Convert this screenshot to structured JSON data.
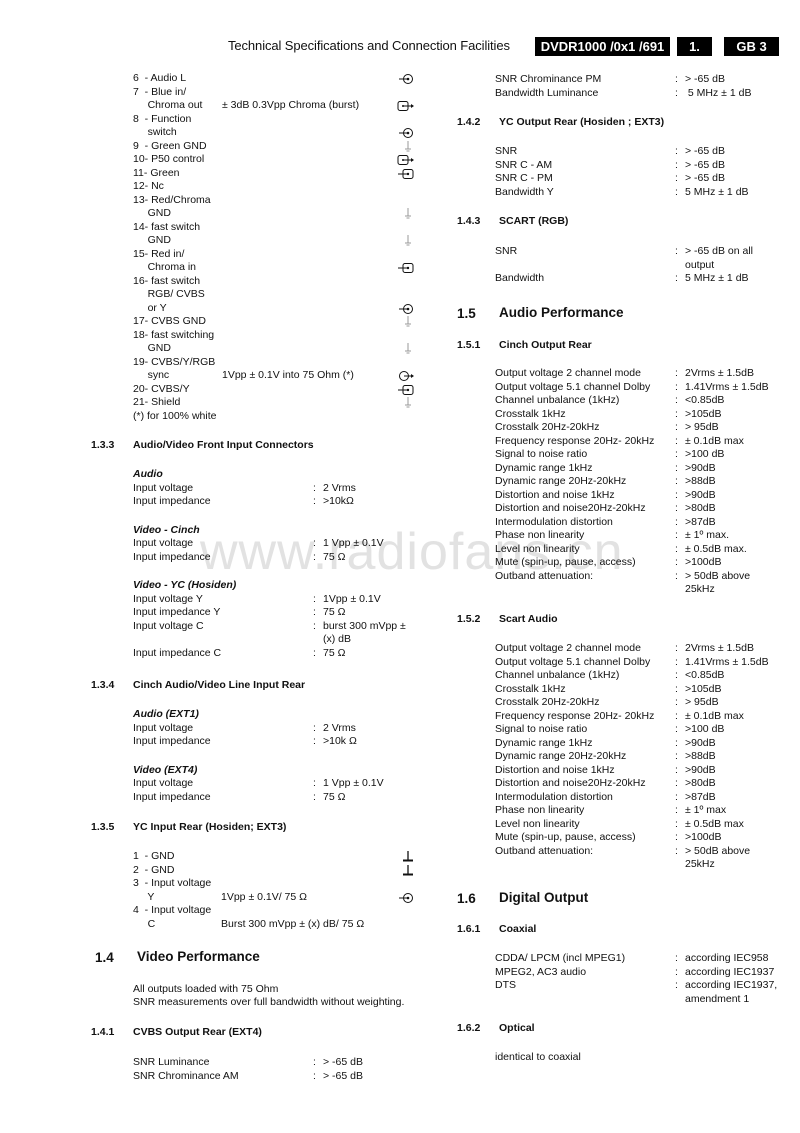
{
  "header": {
    "title": "Technical Specifications and Connection Facilities",
    "model": "DVDR1000 /0x1 /691",
    "chapter": "1.",
    "page": "GB 3"
  },
  "watermark": "www.radiofans.cn",
  "scart_pins": [
    {
      "lines": [
        "6  - Audio L"
      ],
      "spec": "",
      "icon": "input-jack-icon"
    },
    {
      "lines": [
        "7  - Blue in/",
        "     Chroma out"
      ],
      "spec": "± 3dB 0.3Vpp Chroma (burst)",
      "icon": "bidirectional-box-output-icon"
    },
    {
      "lines": [
        "8  - Function",
        "     switch"
      ],
      "spec": "",
      "icon": "input-jack-icon"
    },
    {
      "lines": [
        "9  - Green GND"
      ],
      "spec": "",
      "icon": "ground-icon"
    },
    {
      "lines": [
        "10- P50 control"
      ],
      "spec": "",
      "icon": "box-output-icon"
    },
    {
      "lines": [
        "11- Green"
      ],
      "spec": "",
      "icon": "box-input-icon"
    },
    {
      "lines": [
        "12- Nc"
      ],
      "spec": "",
      "icon": ""
    },
    {
      "lines": [
        "13- Red/Chroma",
        "     GND"
      ],
      "spec": "",
      "icon": "ground-icon"
    },
    {
      "lines": [
        "14- fast switch",
        "     GND"
      ],
      "spec": "",
      "icon": "ground-icon"
    },
    {
      "lines": [
        "15- Red in/",
        "     Chroma in"
      ],
      "spec": "",
      "icon": "box-input-icon"
    },
    {
      "lines": [
        "16- fast switch",
        "     RGB/ CVBS",
        "     or Y"
      ],
      "spec": "",
      "icon": "input-jack-icon"
    },
    {
      "lines": [
        "17- CVBS GND"
      ],
      "spec": "",
      "icon": "ground-icon"
    },
    {
      "lines": [
        "18- fast switching",
        "     GND"
      ],
      "spec": "",
      "icon": "ground-icon"
    },
    {
      "lines": [
        "19- CVBS/Y/RGB",
        "     sync"
      ],
      "spec": "1Vpp ± 0.1V into 75 Ohm (*)",
      "icon": "output-jack-icon"
    },
    {
      "lines": [
        "20- CVBS/Y"
      ],
      "spec": "",
      "icon": "box-input-icon"
    },
    {
      "lines": [
        "21- Shield"
      ],
      "spec": "",
      "icon": "ground-icon"
    },
    {
      "lines": [
        "(*) for 100% white"
      ],
      "spec": "",
      "icon": ""
    }
  ],
  "s133": {
    "num": "1.3.3",
    "title": "Audio/Video Front Input Connectors",
    "groups": [
      {
        "heading": "Audio",
        "rows": [
          {
            "label": "Input voltage",
            "value": "2 Vrms"
          },
          {
            "label": "Input impedance",
            "value": ">10kΩ"
          }
        ]
      },
      {
        "heading": "Video - Cinch",
        "rows": [
          {
            "label": "Input voltage",
            "value": "1 Vpp ± 0.1V"
          },
          {
            "label": "Input impedance",
            "value": "75 Ω"
          }
        ]
      },
      {
        "heading": "Video - YC (Hosiden)",
        "rows": [
          {
            "label": "Input voltage Y",
            "value": "1Vpp ± 0.1V"
          },
          {
            "label": "Input impedance Y",
            "value": "75 Ω"
          },
          {
            "label": "Input voltage C",
            "value": "burst 300 mVpp ±",
            "value2": "(x) dB"
          },
          {
            "label": "Input impedance C",
            "value": "75 Ω"
          }
        ]
      }
    ]
  },
  "s134": {
    "num": "1.3.4",
    "title": "Cinch Audio/Video Line Input Rear",
    "groups": [
      {
        "heading": "Audio (EXT1)",
        "rows": [
          {
            "label": "Input voltage",
            "value": "2 Vrms"
          },
          {
            "label": "Input impedance",
            "value": ">10k Ω"
          }
        ]
      },
      {
        "heading": "Video (EXT4)",
        "rows": [
          {
            "label": "Input voltage",
            "value": "1 Vpp ± 0.1V"
          },
          {
            "label": "Input impedance",
            "value": "75 Ω"
          }
        ]
      }
    ]
  },
  "s135": {
    "num": "1.3.5",
    "title": "YC  Input Rear (Hosiden; EXT3)",
    "pins": [
      {
        "lines": [
          "1  - GND"
        ],
        "spec": "",
        "icon": "ground-bar-icon"
      },
      {
        "lines": [
          "2  - GND"
        ],
        "spec": "",
        "icon": "ground-bar-icon"
      },
      {
        "lines": [
          "3  - Input voltage",
          "     Y"
        ],
        "spec": "1Vpp ± 0.1V/ 75 Ω",
        "icon": "input-jack-icon"
      },
      {
        "lines": [
          "4  - Input voltage",
          "     C"
        ],
        "spec": "Burst 300 mVpp ± (x) dB/ 75 Ω",
        "icon": ""
      }
    ]
  },
  "s14": {
    "num": "1.4",
    "title": "Video Performance",
    "notes": [
      "All outputs loaded with 75 Ohm",
      "SNR measurements over full bandwidth without weighting."
    ]
  },
  "s141": {
    "num": "1.4.1",
    "title": "CVBS Output Rear (EXT4)",
    "rows": [
      {
        "label": "SNR Luminance",
        "value": "> -65 dB"
      },
      {
        "label": "SNR Chrominance AM",
        "value": "> -65 dB"
      },
      {
        "label": "SNR Chrominance PM",
        "value": "> -65 dB"
      },
      {
        "label": "Bandwidth Luminance",
        "value": " 5 MHz ± 1 dB"
      }
    ]
  },
  "s142": {
    "num": "1.4.2",
    "title": "YC Output Rear (Hosiden ; EXT3)",
    "rows": [
      {
        "label": "SNR",
        "value": "> -65 dB"
      },
      {
        "label": "SNR C - AM",
        "value": "> -65 dB"
      },
      {
        "label": "SNR C - PM",
        "value": "> -65 dB"
      },
      {
        "label": "Bandwidth Y",
        "value": "5 MHz ± 1 dB"
      }
    ]
  },
  "s143": {
    "num": "1.4.3",
    "title": "SCART (RGB)",
    "rows": [
      {
        "label": "SNR",
        "value": "> -65 dB on all",
        "value2": "output"
      },
      {
        "label": "Bandwidth",
        "value": "5 MHz ± 1 dB"
      }
    ]
  },
  "s15": {
    "num": "1.5",
    "title": "Audio Performance"
  },
  "s151": {
    "num": "1.5.1",
    "title": "Cinch Output Rear",
    "rows": [
      {
        "label": "Output voltage 2 channel mode",
        "value": "2Vrms ± 1.5dB"
      },
      {
        "label": "Output voltage 5.1 channel Dolby",
        "value": "1.41Vrms ± 1.5dB"
      },
      {
        "label": "Channel unbalance (1kHz)",
        "value": "<0.85dB"
      },
      {
        "label": "Crosstalk 1kHz",
        "value": ">105dB"
      },
      {
        "label": "Crosstalk 20Hz-20kHz",
        "value": "> 95dB"
      },
      {
        "label": "Frequency response 20Hz- 20kHz",
        "value": "± 0.1dB max"
      },
      {
        "label": "Signal to noise ratio",
        "value": ">100 dB"
      },
      {
        "label": "Dynamic range 1kHz",
        "value": ">90dB"
      },
      {
        "label": "Dynamic range 20Hz-20kHz",
        "value": ">88dB"
      },
      {
        "label": "Distortion and noise 1kHz",
        "value": ">90dB"
      },
      {
        "label": "Distortion and noise20Hz-20kHz",
        "value": ">80dB"
      },
      {
        "label": "Intermodulation distortion",
        "value": ">87dB"
      },
      {
        "label": "Phase non linearity",
        "value": "± 1º max."
      },
      {
        "label": "Level non linearity",
        "value": "± 0.5dB max."
      },
      {
        "label": "Mute (spin-up, pause, access)",
        "value": ">100dB"
      },
      {
        "label": "Outband attenuation:",
        "value": "> 50dB above",
        "value2": "25kHz"
      }
    ]
  },
  "s152": {
    "num": "1.5.2",
    "title": "Scart Audio",
    "rows": [
      {
        "label": "Output voltage 2 channel mode",
        "value": "2Vrms ± 1.5dB"
      },
      {
        "label": "Output voltage 5.1 channel Dolby",
        "value": "1.41Vrms ± 1.5dB"
      },
      {
        "label": "Channel unbalance (1kHz)",
        "value": "<0.85dB"
      },
      {
        "label": "Crosstalk 1kHz",
        "value": ">105dB"
      },
      {
        "label": "Crosstalk 20Hz-20kHz",
        "value": "> 95dB"
      },
      {
        "label": "Frequency response 20Hz- 20kHz",
        "value": "± 0.1dB max"
      },
      {
        "label": "Signal to noise ratio",
        "value": ">100 dB"
      },
      {
        "label": "Dynamic range 1kHz",
        "value": ">90dB"
      },
      {
        "label": "Dynamic range 20Hz-20kHz",
        "value": ">88dB"
      },
      {
        "label": "Distortion and noise 1kHz",
        "value": ">90dB"
      },
      {
        "label": "Distortion and noise20Hz-20kHz",
        "value": ">80dB"
      },
      {
        "label": "Intermodulation distortion",
        "value": ">87dB"
      },
      {
        "label": "Phase non linearity",
        "value": "± 1º max"
      },
      {
        "label": "Level non linearity",
        "value": "± 0.5dB max"
      },
      {
        "label": "Mute (spin-up, pause, access)",
        "value": ">100dB"
      },
      {
        "label": "Outband attenuation:",
        "value": "> 50dB above",
        "value2": "25kHz"
      }
    ]
  },
  "s16": {
    "num": "1.6",
    "title": "Digital Output"
  },
  "s161": {
    "num": "1.6.1",
    "title": "Coaxial",
    "rows": [
      {
        "label": "CDDA/ LPCM (incl MPEG1)",
        "value": "according IEC958"
      },
      {
        "label": "MPEG2, AC3 audio",
        "value": "according IEC1937"
      },
      {
        "label": "DTS",
        "value": "according IEC1937,",
        "value2": "amendment 1"
      }
    ]
  },
  "s162": {
    "num": "1.6.2",
    "title": "Optical",
    "note": "identical to coaxial"
  },
  "separator": ":"
}
